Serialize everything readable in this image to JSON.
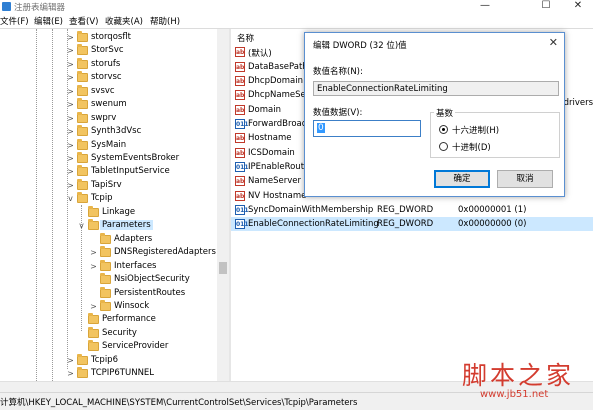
{
  "window": {
    "title": "注册表编辑器",
    "minimize_glyph": "—",
    "maximize_glyph": "☐",
    "close_glyph": "✕"
  },
  "menu": [
    "文件(F)",
    "编辑(E)",
    "查看(V)",
    "收藏夹(A)",
    "帮助(H)"
  ],
  "tree": {
    "items": [
      {
        "label": "storqosflt",
        "expander": ">"
      },
      {
        "label": "StorSvc",
        "expander": ">"
      },
      {
        "label": "storufs",
        "expander": ">"
      },
      {
        "label": "storvsc",
        "expander": ">"
      },
      {
        "label": "svsvc",
        "expander": ">"
      },
      {
        "label": "swenum",
        "expander": ">"
      },
      {
        "label": "swprv",
        "expander": ">"
      },
      {
        "label": "Synth3dVsc",
        "expander": ">"
      },
      {
        "label": "SysMain",
        "expander": ">"
      },
      {
        "label": "SystemEventsBroker",
        "expander": ">"
      },
      {
        "label": "TabletInputService",
        "expander": ">"
      },
      {
        "label": "TapiSrv",
        "expander": ">"
      },
      {
        "label": "Tcpip",
        "expander": "v"
      },
      {
        "label": "Linkage",
        "expander": ""
      },
      {
        "label": "Parameters",
        "expander": "v"
      },
      {
        "label": "Adapters",
        "expander": ""
      },
      {
        "label": "DNSRegisteredAdapters",
        "expander": ">"
      },
      {
        "label": "Interfaces",
        "expander": ">"
      },
      {
        "label": "NsiObjectSecurity",
        "expander": ""
      },
      {
        "label": "PersistentRoutes",
        "expander": ""
      },
      {
        "label": "Winsock",
        "expander": ">"
      },
      {
        "label": "Performance",
        "expander": ""
      },
      {
        "label": "Security",
        "expander": ""
      },
      {
        "label": "ServiceProvider",
        "expander": ""
      },
      {
        "label": "Tcpip6",
        "expander": ">"
      },
      {
        "label": "TCPIP6TUNNEL",
        "expander": ">"
      }
    ]
  },
  "list": {
    "col_name": "名称",
    "truncated_data": "drivers",
    "rows": [
      {
        "name": "(默认)",
        "icon": "ab",
        "type": "",
        "data": ""
      },
      {
        "name": "DataBasePath",
        "icon": "ab",
        "type": "",
        "data": ""
      },
      {
        "name": "DhcpDomain",
        "icon": "ab",
        "type": "",
        "data": ""
      },
      {
        "name": "DhcpNameServer",
        "icon": "ab",
        "type": "",
        "data": ""
      },
      {
        "name": "Domain",
        "icon": "ab",
        "type": "",
        "data": ""
      },
      {
        "name": "ForwardBroadcasts",
        "icon": "011",
        "type": "",
        "data": ""
      },
      {
        "name": "Hostname",
        "icon": "ab",
        "type": "",
        "data": ""
      },
      {
        "name": "ICSDomain",
        "icon": "ab",
        "type": "",
        "data": ""
      },
      {
        "name": "IPEnableRouter",
        "icon": "011",
        "type": "",
        "data": ""
      },
      {
        "name": "NameServer",
        "icon": "ab",
        "type": "",
        "data": ""
      },
      {
        "name": "NV Hostname",
        "icon": "ab",
        "type": "",
        "data": ""
      },
      {
        "name": "SyncDomainWithMembership",
        "icon": "011",
        "type": "REG_DWORD",
        "data": "0x00000001 (1)"
      },
      {
        "name": "EnableConnectionRateLimiting",
        "icon": "011",
        "type": "REG_DWORD",
        "data": "0x00000000 (0)"
      }
    ]
  },
  "status": {
    "path": "计算机\\HKEY_LOCAL_MACHINE\\SYSTEM\\CurrentControlSet\\Services\\Tcpip\\Parameters"
  },
  "dialog": {
    "title": "编辑 DWORD (32 位)值",
    "close_glyph": "✕",
    "name_label": "数值名称(N):",
    "name_value": "EnableConnectionRateLimiting",
    "data_label": "数值数据(V):",
    "data_value": "0",
    "radix_label": "基数",
    "hex_label": "十六进制(H)",
    "dec_label": "十进制(D)",
    "selected_radix": "hex",
    "ok_label": "确定",
    "cancel_label": "取消"
  },
  "watermark": {
    "text": "脚本之家",
    "url": "www.jb51.net"
  },
  "colors": {
    "selection": "#cce8ff",
    "dialog_border": "#5a8fd0",
    "watermark": "#d33c2f"
  }
}
